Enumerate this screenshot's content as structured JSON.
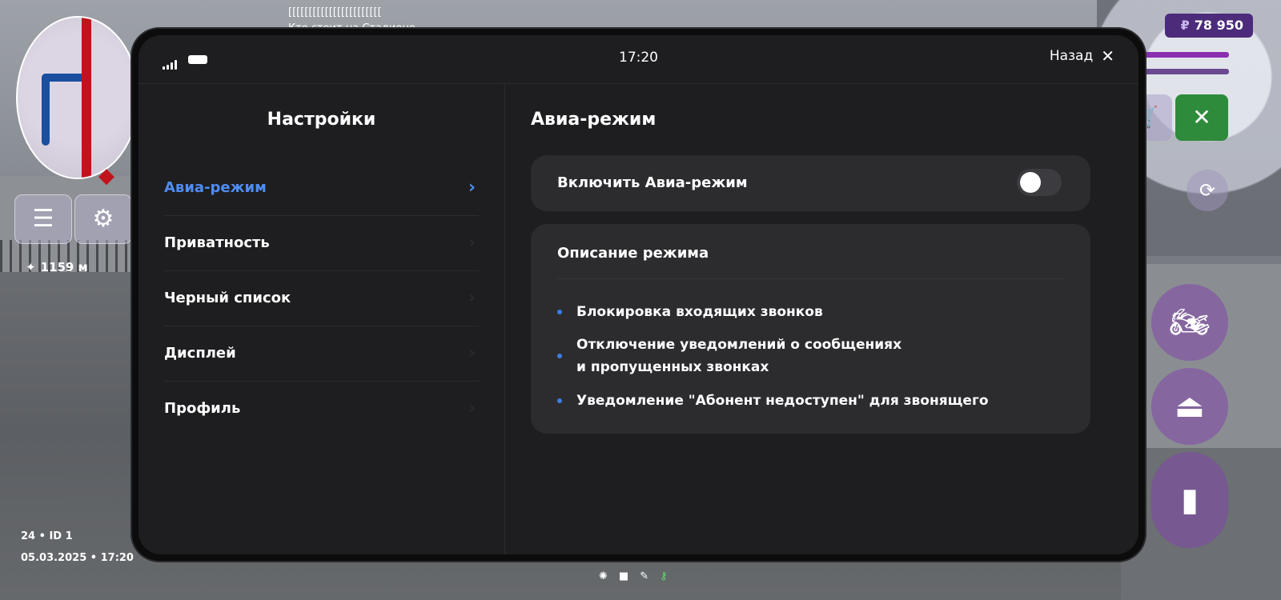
{
  "hud": {
    "distance": "1159 м",
    "info_line1": "24 • ID 1",
    "info_line2": "05.03.2025 • 17:20",
    "money_symbol": "₽",
    "money": "78 950",
    "chat_line1": "[[[[[[[[[[[[[[[[[[[[[[[",
    "chat_line2": "Кто стоит на Стадионе"
  },
  "phone": {
    "time": "17:20",
    "back_label": "Назад",
    "sidebar": {
      "title": "Настройки",
      "items": [
        {
          "label": "Авиа-режим",
          "active": true
        },
        {
          "label": "Приватность"
        },
        {
          "label": "Черный список"
        },
        {
          "label": "Дисплей"
        },
        {
          "label": "Профиль"
        }
      ]
    },
    "content": {
      "title": "Авиа-режим",
      "toggle_label": "Включить Авиа-режим",
      "toggle_on": false,
      "description_title": "Описание режима",
      "bullets": [
        "Блокировка входящих звонков",
        "Отключение уведомлений о сообщениях",
        "и пропущенных звонках",
        "Уведомление \"Абонент недоступен\" для звонящего"
      ]
    }
  },
  "colors": {
    "accent": "#4f8cf2",
    "panel": "#1e1e20",
    "card": "#2c2c2f",
    "money_bg": "#4b2b7a"
  },
  "icons": [
    "signal-icon",
    "battery-icon",
    "close-icon",
    "chevron-right-icon",
    "menu-icon",
    "settings-icon",
    "cart-icon",
    "weapon-icon",
    "camera-icon",
    "motorcycle-icon",
    "brake-icon",
    "gas-pedal-icon",
    "map-marker-icon",
    "key-icon"
  ]
}
